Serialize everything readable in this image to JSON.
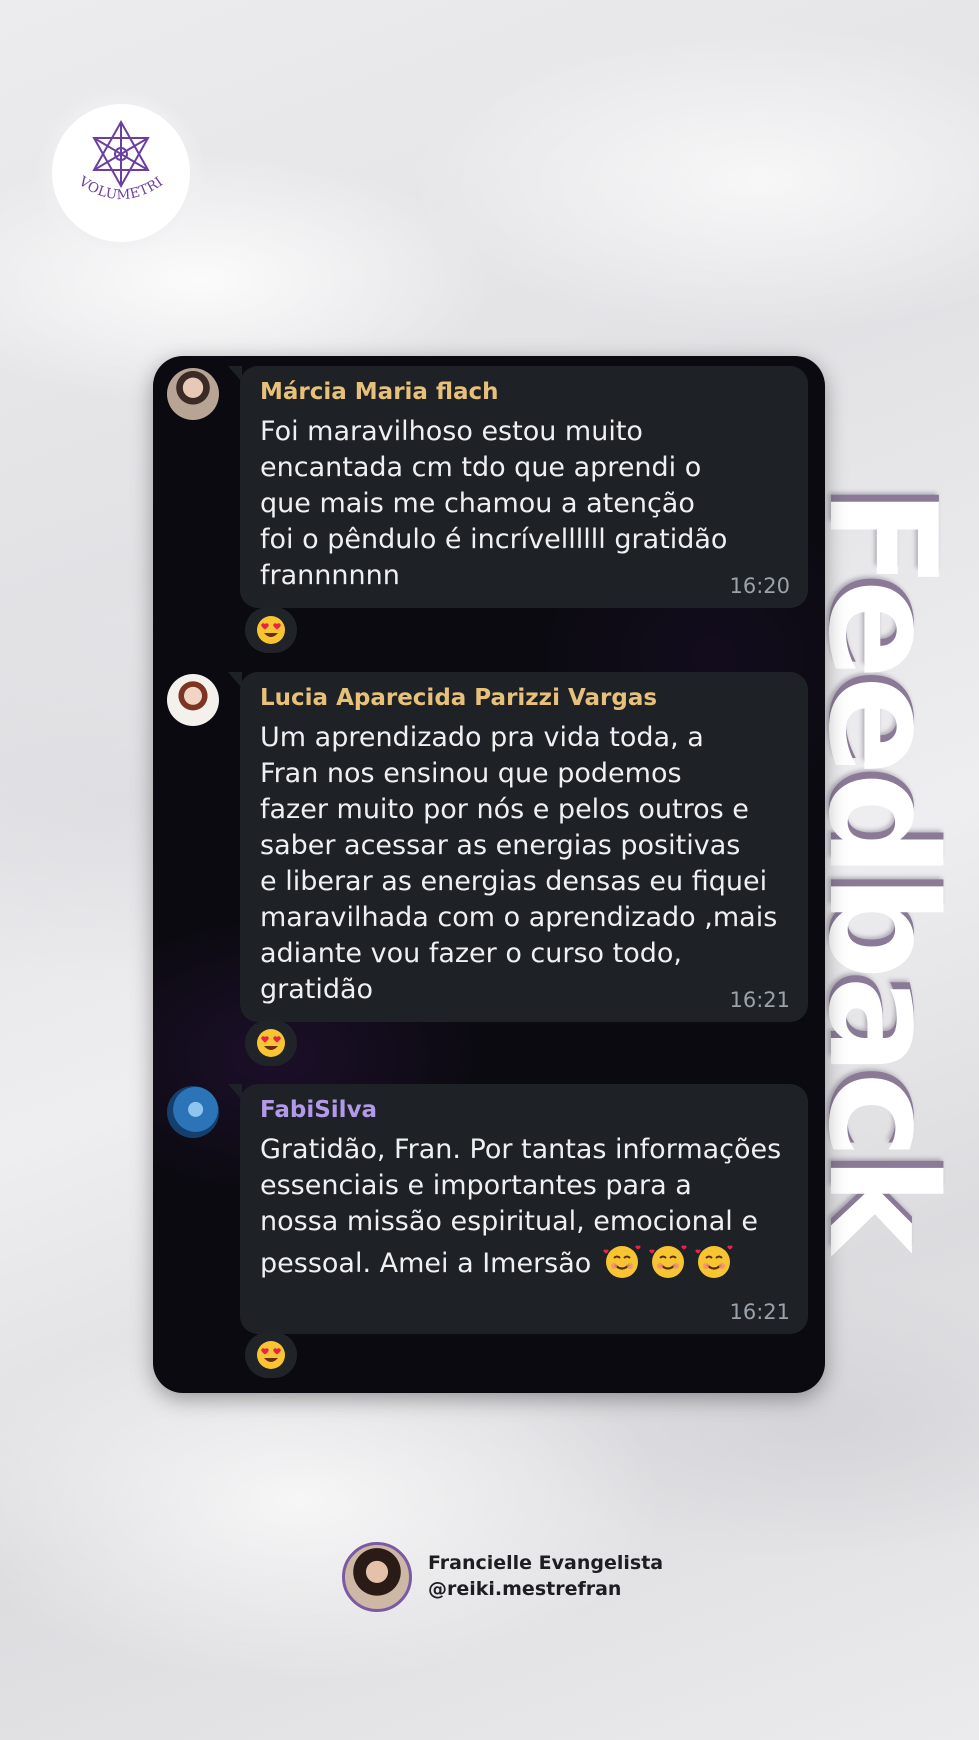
{
  "brand": {
    "logo_text": "EVOLUMETRIA",
    "accent_color": "#6b3fa0"
  },
  "title_vertical": "Feedback",
  "messages": [
    {
      "sender": "Márcia Maria flach",
      "text": "Foi maravilhoso estou muito\nencantada cm tdo que aprendi o\nque mais me chamou a atenção\nfoi o pêndulo é incrívellllll gratidão\nfrannnnnn",
      "time": "16:20",
      "reaction_icon": "heart-eyes-emoji"
    },
    {
      "sender": "Lucia Aparecida Parizzi Vargas",
      "text": "Um aprendizado pra vida toda, a\nFran nos ensinou que podemos\nfazer muito por nós e pelos outros e\nsaber acessar as energias positivas\ne liberar as energias densas eu fiquei\nmaravilhada com o aprendizado ,mais\nadiante vou fazer o curso todo,\ngratidão",
      "time": "16:21",
      "reaction_icon": "heart-eyes-emoji"
    },
    {
      "sender": "FabiSilva",
      "text": "Gratidão, Fran. Por tantas informações\nessenciais e importantes para a\nnossa missão espiritual, emocional e\npessoal.  Amei a Imersão",
      "inline_emoji": "smiling-face-with-hearts-emoji",
      "time": "16:21",
      "reaction_icon": "heart-eyes-emoji"
    }
  ],
  "profile": {
    "name": "Francielle Evangelista",
    "handle": "@reiki.mestrefran"
  }
}
